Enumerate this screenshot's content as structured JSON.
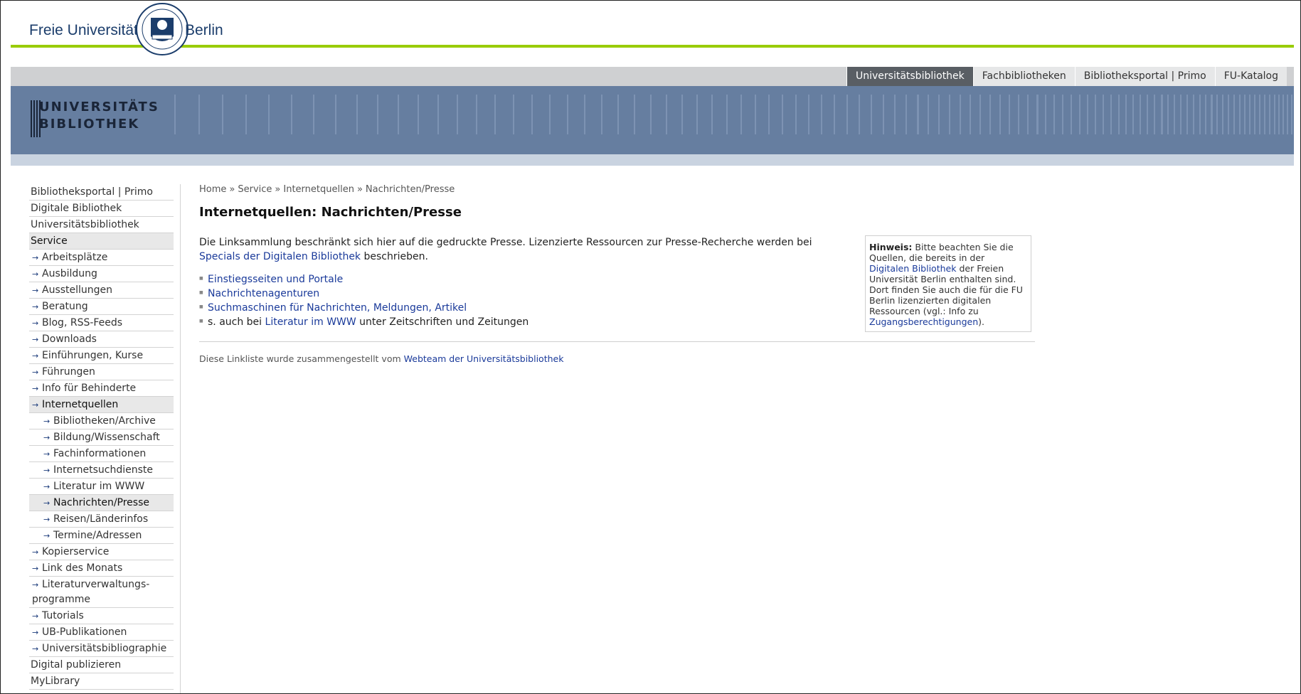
{
  "header": {
    "fu_name_left": "Freie Universität",
    "fu_name_right": "Berlin",
    "tabs": [
      "Universitätsbibliothek",
      "Fachbibliotheken",
      "Bibliotheksportal | Primo",
      "FU-Katalog"
    ],
    "active_tab": "Universitätsbibliothek",
    "ub_logo_line1": "UNIVERSITÄTS",
    "ub_logo_line2": "BIBLIOTHEK"
  },
  "colors": {
    "accent_green": "#99cc00",
    "banner_blue": "#667ea0",
    "link_blue": "#1a3a9a",
    "active_tab_bg": "#595e64"
  },
  "sidebar": {
    "items": [
      {
        "label": "Bibliotheksportal | Primo",
        "level": 1,
        "arrow": false,
        "selected": false
      },
      {
        "label": "Digitale Bibliothek",
        "level": 1,
        "arrow": false,
        "selected": false
      },
      {
        "label": "Universitätsbibliothek",
        "level": 1,
        "arrow": false,
        "selected": false
      },
      {
        "label": "Service",
        "level": 1,
        "arrow": false,
        "selected": true
      },
      {
        "label": "Arbeitsplätze",
        "level": 2,
        "arrow": true,
        "selected": false
      },
      {
        "label": "Ausbildung",
        "level": 2,
        "arrow": true,
        "selected": false
      },
      {
        "label": "Ausstellungen",
        "level": 2,
        "arrow": true,
        "selected": false
      },
      {
        "label": "Beratung",
        "level": 2,
        "arrow": true,
        "selected": false
      },
      {
        "label": "Blog, RSS-Feeds",
        "level": 2,
        "arrow": true,
        "selected": false
      },
      {
        "label": "Downloads",
        "level": 2,
        "arrow": true,
        "selected": false
      },
      {
        "label": "Einführungen, Kurse",
        "level": 2,
        "arrow": true,
        "selected": false
      },
      {
        "label": "Führungen",
        "level": 2,
        "arrow": true,
        "selected": false
      },
      {
        "label": "Info für Behinderte",
        "level": 2,
        "arrow": true,
        "selected": false
      },
      {
        "label": "Internetquellen",
        "level": 2,
        "arrow": true,
        "selected": true
      },
      {
        "label": "Bibliotheken/Archive",
        "level": 3,
        "arrow": true,
        "selected": false
      },
      {
        "label": "Bildung/Wissenschaft",
        "level": 3,
        "arrow": true,
        "selected": false
      },
      {
        "label": "Fachinformationen",
        "level": 3,
        "arrow": true,
        "selected": false
      },
      {
        "label": "Internetsuchdienste",
        "level": 3,
        "arrow": true,
        "selected": false
      },
      {
        "label": "Literatur im WWW",
        "level": 3,
        "arrow": true,
        "selected": false
      },
      {
        "label": "Nachrichten/Presse",
        "level": 3,
        "arrow": true,
        "selected": true
      },
      {
        "label": "Reisen/Länderinfos",
        "level": 3,
        "arrow": true,
        "selected": false
      },
      {
        "label": "Termine/Adressen",
        "level": 3,
        "arrow": true,
        "selected": false
      },
      {
        "label": "Kopierservice",
        "level": 2,
        "arrow": true,
        "selected": false
      },
      {
        "label": "Link des Monats",
        "level": 2,
        "arrow": true,
        "selected": false
      },
      {
        "label": "Literaturverwaltungs-programme",
        "level": 2,
        "arrow": true,
        "selected": false
      },
      {
        "label": "Tutorials",
        "level": 2,
        "arrow": true,
        "selected": false
      },
      {
        "label": "UB-Publikationen",
        "level": 2,
        "arrow": true,
        "selected": false
      },
      {
        "label": "Universitätsbibliographie",
        "level": 2,
        "arrow": true,
        "selected": false
      },
      {
        "label": "Digital publizieren",
        "level": 1,
        "arrow": false,
        "selected": false
      },
      {
        "label": "MyLibrary",
        "level": 1,
        "arrow": false,
        "selected": false
      }
    ]
  },
  "breadcrumb": {
    "items": [
      "Home",
      "Service",
      "Internetquellen",
      "Nachrichten/Presse"
    ],
    "separator": "»"
  },
  "main": {
    "title": "Internetquellen: Nachrichten/Presse",
    "intro_text": "Die Linksammlung beschränkt sich hier auf die gedruckte Presse. Lizenzierte Ressourcen zur Presse-Recherche werden bei",
    "intro_link": "Specials der Digitalen Bibliothek",
    "intro_after": "beschrieben.",
    "links": [
      "Einstiegsseiten und Portale",
      "Nachrichtenagenturen",
      "Suchmaschinen für Nachrichten, Meldungen, Artikel"
    ],
    "see_also_prefix": "s. auch bei",
    "see_also_link": "Literatur im WWW",
    "see_also_suffix": "unter Zeitschriften und Zeitungen"
  },
  "hint": {
    "label": "Hinweis:",
    "text1": "Bitte beachten Sie die Quellen, die bereits in der",
    "link1": "Digitalen Bibliothek",
    "text2": "der Freien Universität Berlin enthalten sind. Dort finden Sie auch die für die FU Berlin lizenzierten digitalen Ressourcen (vgl.: Info zu",
    "link2": "Zugangsberechtigungen",
    "text3": ")."
  },
  "footer": {
    "text": "Diese Linkliste wurde zusammengestellt vom",
    "link": "Webteam der Universitätsbibliothek"
  }
}
